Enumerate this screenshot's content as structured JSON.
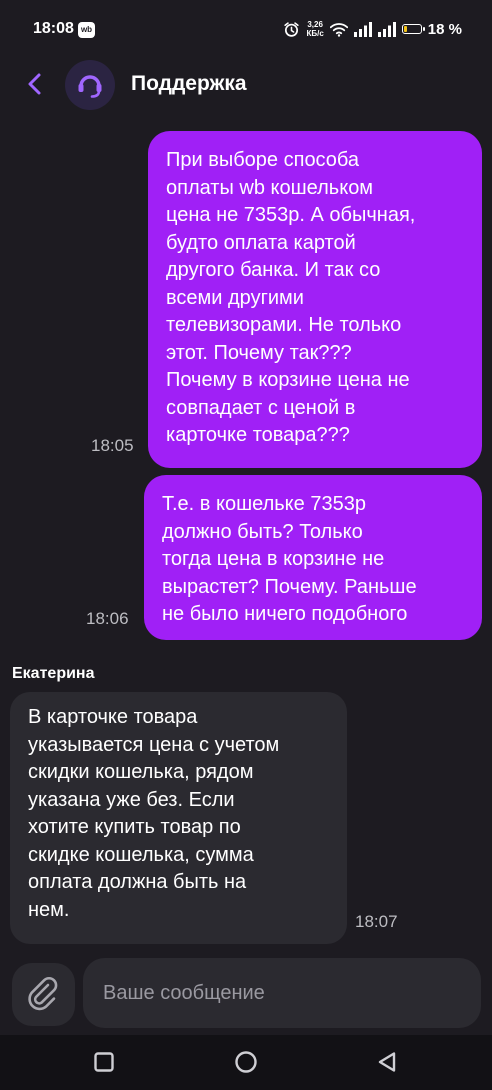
{
  "status_bar": {
    "time": "18:08",
    "app_badge": "wb",
    "net_speed_value": "3,26",
    "net_speed_unit": "КБ/с",
    "battery": "18 %",
    "battery_level": 0.18
  },
  "header": {
    "title": "Поддержка"
  },
  "messages": [
    {
      "direction": "outgoing",
      "text": "При выборе способа\nоплаты wb кошельком\nцена не 7353р. А обычная,\nбудто оплата картой\nдругого банка. И так со\nвсеми другими\nтелевизорами. Не только\nэтот. Почему так???\nПочему в корзине цена не\nсовпадает с ценой в\nкарточке товара???",
      "time": "18:05"
    },
    {
      "direction": "outgoing",
      "text": "Т.е. в кошельке 7353р\nдолжно быть? Только\nтогда цена в корзине не\nвырастет? Почему. Раньше\nне было ничего подобного",
      "time": "18:06"
    },
    {
      "direction": "incoming",
      "sender": "Екатерина",
      "text": "В карточке товара\nуказывается цена с учетом\nскидки кошелька, рядом\nуказана уже без. Если\nхотите купить товар по\nскидке кошелька, сумма\nоплата должна быть на\nнем.",
      "time": "18:07"
    }
  ],
  "composer": {
    "placeholder": "Ваше сообщение",
    "attach_icon": "paperclip-icon"
  },
  "nav_bar": {
    "buttons": [
      "recents-square-icon",
      "home-circle-icon",
      "back-triangle-icon"
    ]
  },
  "colors": {
    "background": "#1d1b21",
    "outgoing_bubble": "#a020f6",
    "incoming_bubble": "#2b2a30",
    "accent": "#a066ff"
  }
}
